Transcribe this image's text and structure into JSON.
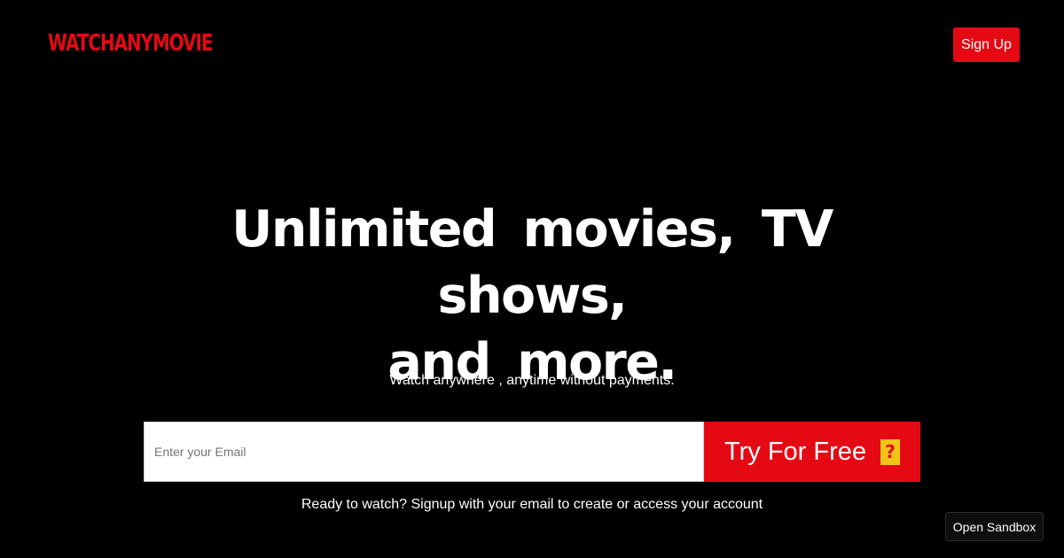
{
  "header": {
    "logo_text": "WATCHANYMOVIE",
    "signup_label": "Sign Up"
  },
  "hero": {
    "headline_line1": "Unlimited movies, TV shows,",
    "headline_line2": "and more.",
    "subtitle": "Watch anywhere , anytime without payments."
  },
  "form": {
    "email_placeholder": "Enter your Email",
    "email_value": "",
    "submit_label": "Try For Free",
    "submit_icon": "unknown-glyph-icon",
    "help_text": "Ready to watch? Signup with your email to create or access your account"
  },
  "sandbox": {
    "label": "Open Sandbox"
  },
  "colors": {
    "background": "#000000",
    "brand_red": "#e50914",
    "text": "#ffffff"
  }
}
